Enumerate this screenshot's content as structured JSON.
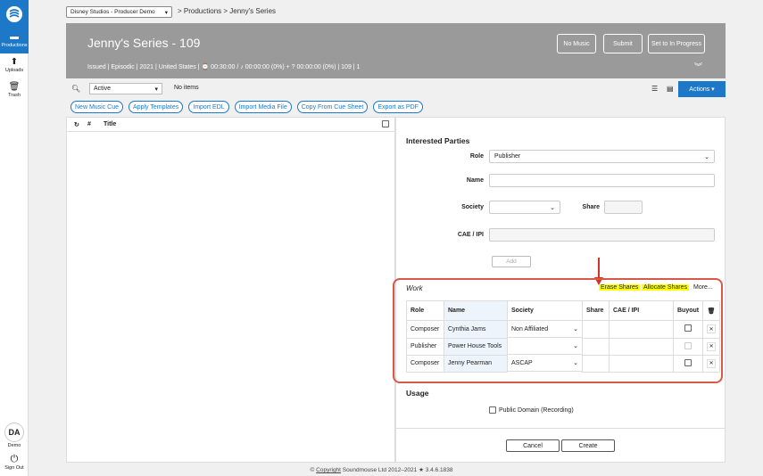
{
  "nav": {
    "items": [
      {
        "label": "Productions",
        "icon": "clapperboard-icon"
      },
      {
        "label": "Uploads",
        "icon": "upload-arrow-icon"
      },
      {
        "label": "Trash",
        "icon": "trash-icon"
      }
    ],
    "user": {
      "initials": "DA",
      "name": "Demo"
    },
    "signout": "Sign Out"
  },
  "topbar": {
    "org": "Disney Studios - Producer Demo",
    "breadcrumb": "> Productions  >  Jenny's Series"
  },
  "header": {
    "title": "Jenny's Series - 109",
    "meta": "Issued | Episodic | 2021 | United States | ⌚ 00:30:00 / ♪ 00:00:00 (0%) + ? 00:00:00 (0%) | 109 | 1",
    "buttons": {
      "no_music": "No Music",
      "submit": "Submit",
      "in_progress": "Set to In Progress"
    }
  },
  "toolbar": {
    "status": "Active",
    "items_count": "No items",
    "actions": "Actions ▾"
  },
  "pills": [
    "New Music Cue",
    "Apply Templates",
    "Import EDL",
    "Import Media File",
    "Copy From Cue Sheet",
    "Export as PDF"
  ],
  "list": {
    "col_num": "#",
    "col_title": "Title"
  },
  "interested_parties": {
    "title": "Interested Parties",
    "role_label": "Role",
    "role_value": "Publisher",
    "name_label": "Name",
    "society_label": "Society",
    "share_label": "Share",
    "cae_label": "CAE / IPI",
    "add": "Add"
  },
  "work": {
    "title": "Work",
    "erase": "Erase Shares",
    "allocate": "Allocate Shares",
    "more": "More...",
    "headers": [
      "Role",
      "Name",
      "Society",
      "Share",
      "CAE / IPI",
      "Buyout"
    ],
    "rows": [
      {
        "role": "Composer",
        "name": "Cynthia Jams",
        "society": "Non Affiliated"
      },
      {
        "role": "Publisher",
        "name": "Power House Tools",
        "society": ""
      },
      {
        "role": "Composer",
        "name": "Jenny Pearman",
        "society": "ASCAP"
      }
    ]
  },
  "usage": {
    "title": "Usage",
    "public_domain": "Public Domain (Recording)"
  },
  "footer": {
    "cancel": "Cancel",
    "create": "Create"
  },
  "copyright": {
    "prefix": "© ",
    "link": "Copyright",
    "suffix": " Soundmouse Ltd 2012–2021 ★ 3.4.6.1838"
  },
  "colors": {
    "brand": "#1e78c8",
    "header": "#9a9a9a",
    "highlight": "#ffff00",
    "callout": "#d9584a"
  }
}
